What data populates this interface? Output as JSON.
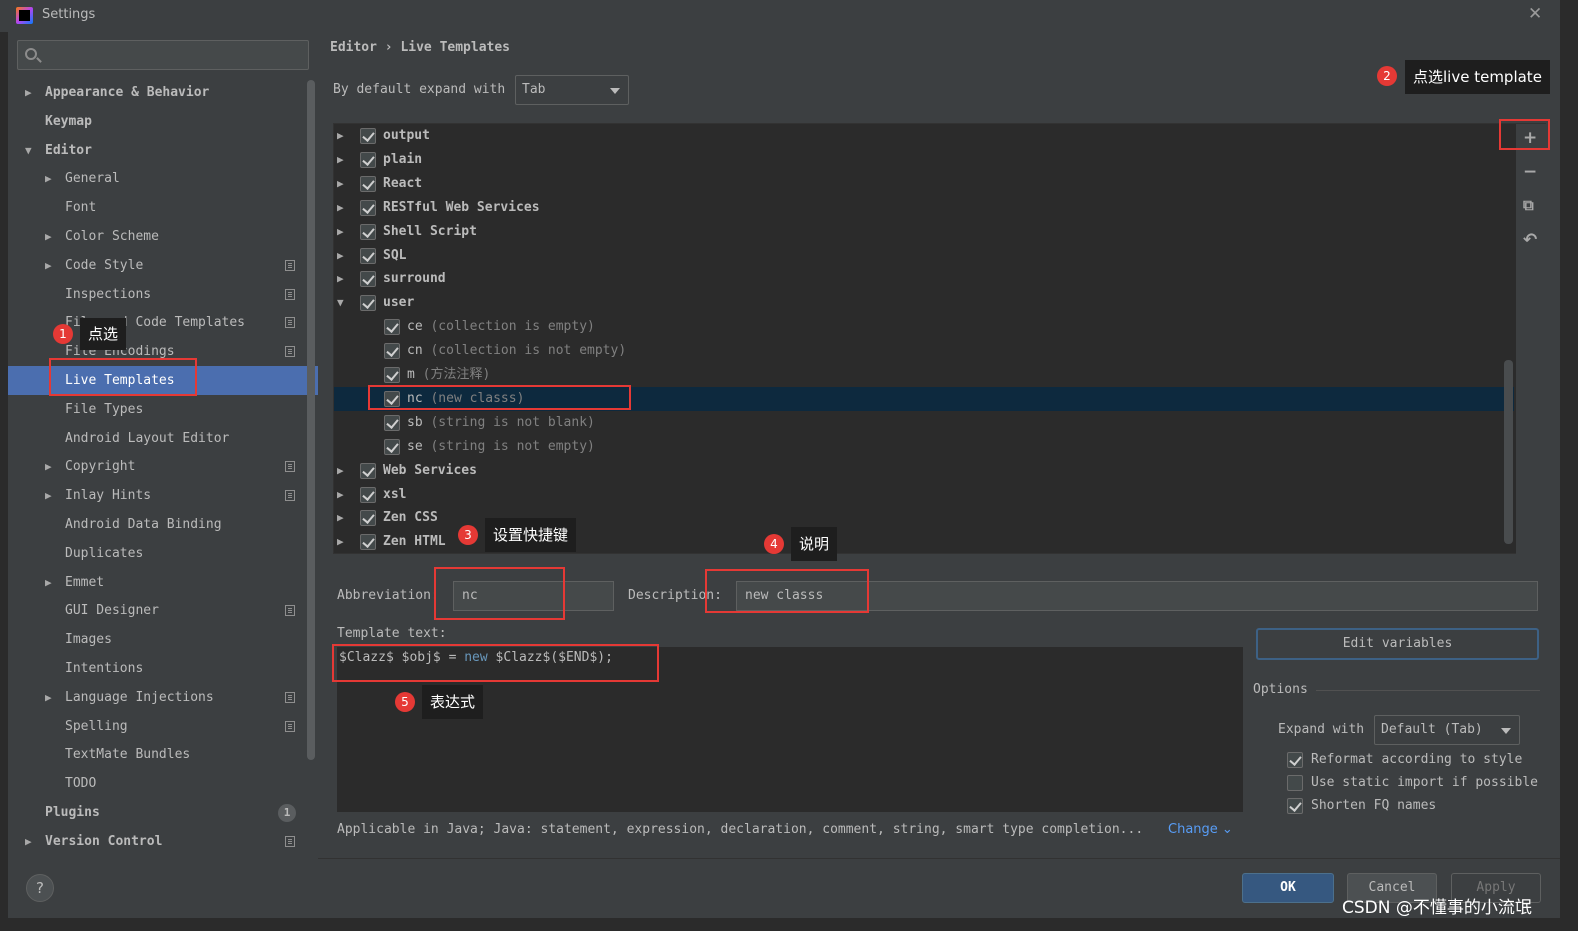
{
  "window": {
    "title": "Settings",
    "close_glyph": "✕"
  },
  "search": {
    "placeholder": ""
  },
  "sidebar": {
    "items": [
      {
        "label": "Appearance & Behavior",
        "bold": true,
        "arrow": "▶",
        "indent": 0
      },
      {
        "label": "Keymap",
        "bold": true,
        "arrow": "",
        "indent": 0
      },
      {
        "label": "Editor",
        "bold": true,
        "arrow": "▼",
        "indent": 0
      },
      {
        "label": "General",
        "arrow": "▶",
        "indent": 1
      },
      {
        "label": "Font",
        "arrow": "",
        "indent": 1
      },
      {
        "label": "Color Scheme",
        "arrow": "▶",
        "indent": 1
      },
      {
        "label": "Code Style",
        "arrow": "▶",
        "indent": 1,
        "copy": true
      },
      {
        "label": "Inspections",
        "arrow": "",
        "indent": 1,
        "copy": true
      },
      {
        "label": "File and Code Templates",
        "arrow": "",
        "indent": 1,
        "copy": true
      },
      {
        "label": "File Encodings",
        "arrow": "",
        "indent": 1,
        "copy": true
      },
      {
        "label": "Live Templates",
        "arrow": "",
        "indent": 1,
        "selected": true
      },
      {
        "label": "File Types",
        "arrow": "",
        "indent": 1
      },
      {
        "label": "Android Layout Editor",
        "arrow": "",
        "indent": 1
      },
      {
        "label": "Copyright",
        "arrow": "▶",
        "indent": 1,
        "copy": true
      },
      {
        "label": "Inlay Hints",
        "arrow": "▶",
        "indent": 1,
        "copy": true
      },
      {
        "label": "Android Data Binding",
        "arrow": "",
        "indent": 1
      },
      {
        "label": "Duplicates",
        "arrow": "",
        "indent": 1
      },
      {
        "label": "Emmet",
        "arrow": "▶",
        "indent": 1
      },
      {
        "label": "GUI Designer",
        "arrow": "",
        "indent": 1,
        "copy": true
      },
      {
        "label": "Images",
        "arrow": "",
        "indent": 1
      },
      {
        "label": "Intentions",
        "arrow": "",
        "indent": 1
      },
      {
        "label": "Language Injections",
        "arrow": "▶",
        "indent": 1,
        "copy": true
      },
      {
        "label": "Spelling",
        "arrow": "",
        "indent": 1,
        "copy": true
      },
      {
        "label": "TextMate Bundles",
        "arrow": "",
        "indent": 1
      },
      {
        "label": "TODO",
        "arrow": "",
        "indent": 1
      },
      {
        "label": "Plugins",
        "bold": true,
        "arrow": "",
        "indent": 0,
        "badge": "1"
      },
      {
        "label": "Version Control",
        "bold": true,
        "arrow": "▶",
        "indent": 0,
        "copy": true
      }
    ]
  },
  "help_label": "?",
  "breadcrumb": "Editor › Live Templates",
  "expand_default": {
    "label": "By default expand with",
    "value": "Tab"
  },
  "templates": [
    {
      "name": "output",
      "desc": "",
      "group": true,
      "arrow": "▶",
      "checked": true
    },
    {
      "name": "plain",
      "desc": "",
      "group": true,
      "arrow": "▶",
      "checked": true
    },
    {
      "name": "React",
      "desc": "",
      "group": true,
      "arrow": "▶",
      "checked": true
    },
    {
      "name": "RESTful Web Services",
      "desc": "",
      "group": true,
      "arrow": "▶",
      "checked": true
    },
    {
      "name": "Shell Script",
      "desc": "",
      "group": true,
      "arrow": "▶",
      "checked": true
    },
    {
      "name": "SQL",
      "desc": "",
      "group": true,
      "arrow": "▶",
      "checked": true
    },
    {
      "name": "surround",
      "desc": "",
      "group": true,
      "arrow": "▶",
      "checked": true
    },
    {
      "name": "user",
      "desc": "",
      "group": true,
      "arrow": "▼",
      "checked": true
    },
    {
      "name": "ce",
      "desc": "(collection is empty)",
      "group": false,
      "checked": true
    },
    {
      "name": "cn",
      "desc": "(collection is not empty)",
      "group": false,
      "checked": true
    },
    {
      "name": "m",
      "desc": "(方法注释)",
      "group": false,
      "checked": true
    },
    {
      "name": "nc",
      "desc": "(new classs)",
      "group": false,
      "checked": true,
      "selected": true
    },
    {
      "name": "sb",
      "desc": "(string is not blank)",
      "group": false,
      "checked": true
    },
    {
      "name": "se",
      "desc": "(string is not empty)",
      "group": false,
      "checked": true
    },
    {
      "name": "Web Services",
      "desc": "",
      "group": true,
      "arrow": "▶",
      "checked": true
    },
    {
      "name": "xsl",
      "desc": "",
      "group": true,
      "arrow": "▶",
      "checked": true
    },
    {
      "name": "Zen CSS",
      "desc": "",
      "group": true,
      "arrow": "▶",
      "checked": true
    },
    {
      "name": "Zen HTML",
      "desc": "",
      "group": true,
      "arrow": "▶",
      "checked": true
    }
  ],
  "toolbar": {
    "add": "+",
    "remove": "−",
    "copy": "⧉",
    "restore": "↶"
  },
  "editor": {
    "abbreviation_label": "Abbreviation:",
    "abbreviation_value": "nc",
    "description_label": "Description:",
    "description_value": "new classs",
    "template_text_label": "Template text:",
    "template_text_parts": [
      "$Clazz$ $obj$ = ",
      "new",
      " $Clazz$($END$);"
    ],
    "applicable": "Applicable in Java; Java: statement, expression, declaration, comment, string, smart type completion...",
    "change_link": "Change ⌄",
    "edit_variables": "Edit variables"
  },
  "options": {
    "title": "Options",
    "expand_with_label": "Expand with",
    "expand_with_value": "Default (Tab)",
    "checkboxes": [
      {
        "label": "Reformat according to style",
        "checked": true
      },
      {
        "label": "Use static import if possible",
        "checked": false
      },
      {
        "label": "Shorten FQ names",
        "checked": true
      }
    ]
  },
  "buttons": {
    "ok": "OK",
    "cancel": "Cancel",
    "apply": "Apply"
  },
  "annotations": [
    {
      "num": "1",
      "text": "点选"
    },
    {
      "num": "2",
      "text": "点选live template"
    },
    {
      "num": "3",
      "text": "设置快捷键"
    },
    {
      "num": "4",
      "text": "说明"
    },
    {
      "num": "5",
      "text": "表达式"
    }
  ],
  "watermark": "CSDN @不懂事的小流氓",
  "colors": {
    "accent": "#4b6eaf",
    "selected_row": "#0d293e",
    "annotation_red": "#e53935",
    "link": "#589df6"
  }
}
